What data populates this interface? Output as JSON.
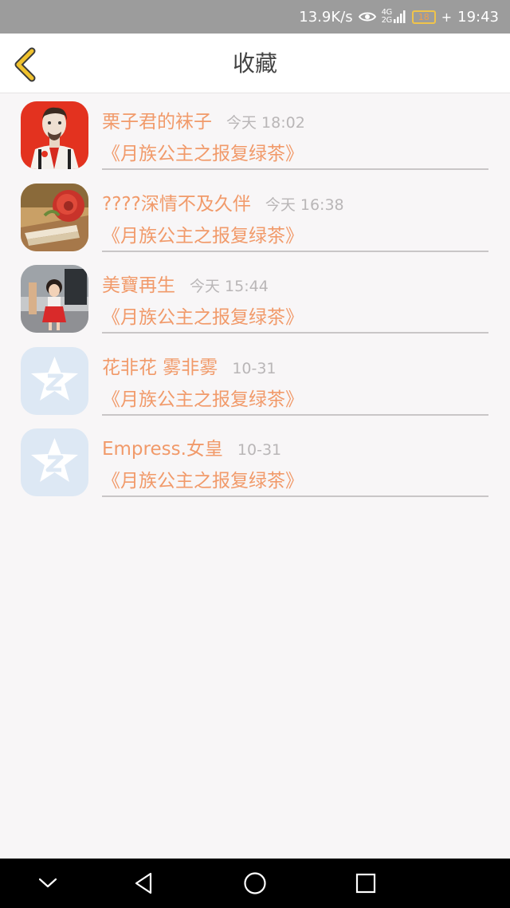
{
  "status_bar": {
    "net_speed": "13.9K/s",
    "network_type": "4G\n2G",
    "battery": "18",
    "battery_level_pct": 18,
    "time": "19:43",
    "icons": [
      "eye-icon",
      "signal-icon",
      "battery-icon",
      "charging-icon"
    ]
  },
  "header": {
    "title": "收藏",
    "back_icon": "chevron-left-icon",
    "accent_color": "#f0c22e"
  },
  "items": [
    {
      "username": "栗子君的袜子",
      "time": "今天 18:02",
      "book": "《月族公主之报复绿茶》",
      "avatar": "illustrated-man-avatar"
    },
    {
      "username": "????深情不及久伴",
      "time": "今天 16:38",
      "book": "《月族公主之报复绿茶》",
      "avatar": "rose-photo-avatar"
    },
    {
      "username": "美寶再生",
      "time": "今天 15:44",
      "book": "《月族公主之报复绿茶》",
      "avatar": "child-photo-avatar"
    },
    {
      "username": "花非花 雾非雾",
      "time": "10-31",
      "book": "《月族公主之报复绿茶》",
      "avatar": "default-star-avatar"
    },
    {
      "username": "Empress.女皇",
      "time": "10-31",
      "book": "《月族公主之报复绿茶》",
      "avatar": "default-star-avatar"
    }
  ],
  "colors": {
    "text_accent": "#f19a6a",
    "time_text": "#b9b6b7",
    "background": "#f8f6f7",
    "status_bar": "#9c9c9c"
  },
  "nav_bar": {
    "buttons": [
      "chevron-down-icon",
      "back-triangle-icon",
      "home-circle-icon",
      "recents-square-icon"
    ]
  }
}
